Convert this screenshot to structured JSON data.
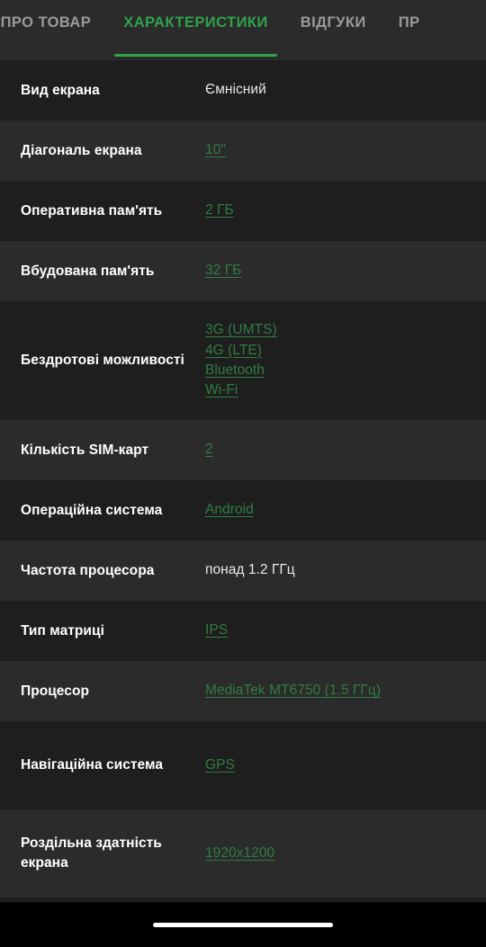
{
  "tabs": [
    {
      "label": "ВСЕ ПРО ТОВАР",
      "active": false
    },
    {
      "label": "ХАРАКТЕРИСТИКИ",
      "active": true
    },
    {
      "label": "ВІДГУКИ",
      "active": false
    },
    {
      "label": "ПР",
      "active": false
    }
  ],
  "colors": {
    "accent_green": "#2ea24c",
    "link_green": "#2f7d42",
    "row_dark": "#1e1e1e",
    "row_light": "#2b2b2b",
    "tabbar_bg": "#2b2b2b",
    "label_text": "#ffffff",
    "value_text": "#e9e9e9",
    "inactive_tab": "#9a9a9a",
    "navbar_bg": "#000000",
    "home_indicator": "#ffffff"
  },
  "specs": [
    {
      "label": "Вид екрана",
      "values": [
        {
          "text": "Ємнісний",
          "link": false
        }
      ]
    },
    {
      "label": "Діагональ екрана",
      "values": [
        {
          "text": "10\"",
          "link": true
        }
      ]
    },
    {
      "label": "Оперативна пам'ять",
      "values": [
        {
          "text": "2 ГБ",
          "link": true
        }
      ]
    },
    {
      "label": "Вбудована пам'ять",
      "values": [
        {
          "text": "32 ГБ",
          "link": true
        }
      ]
    },
    {
      "label": "Бездротові можливості",
      "values": [
        {
          "text": "3G (UMTS)",
          "link": true
        },
        {
          "text": "4G (LTE)",
          "link": true
        },
        {
          "text": "Bluetooth",
          "link": true
        },
        {
          "text": "Wi-Fi",
          "link": true
        }
      ]
    },
    {
      "label": "Кількість SIM-карт",
      "values": [
        {
          "text": "2",
          "link": true
        }
      ]
    },
    {
      "label": "Операційна система",
      "values": [
        {
          "text": "Android",
          "link": true
        }
      ]
    },
    {
      "label": "Частота процесора",
      "values": [
        {
          "text": "понад 1.2 ГГц",
          "link": false
        }
      ]
    },
    {
      "label": "Тип матриці",
      "values": [
        {
          "text": "IPS",
          "link": true
        }
      ]
    },
    {
      "label": "Процесор",
      "values": [
        {
          "text": "MediaTek MT6750 (1.5 ГГц)",
          "link": true
        }
      ]
    },
    {
      "label": "Навігаційна система",
      "values": [
        {
          "text": "GPS",
          "link": true
        }
      ]
    },
    {
      "label": "Роздільна здатність екрана",
      "values": [
        {
          "text": "1920x1200",
          "link": true
        }
      ]
    }
  ],
  "navbar": {
    "home_indicator_name": "home-indicator"
  }
}
